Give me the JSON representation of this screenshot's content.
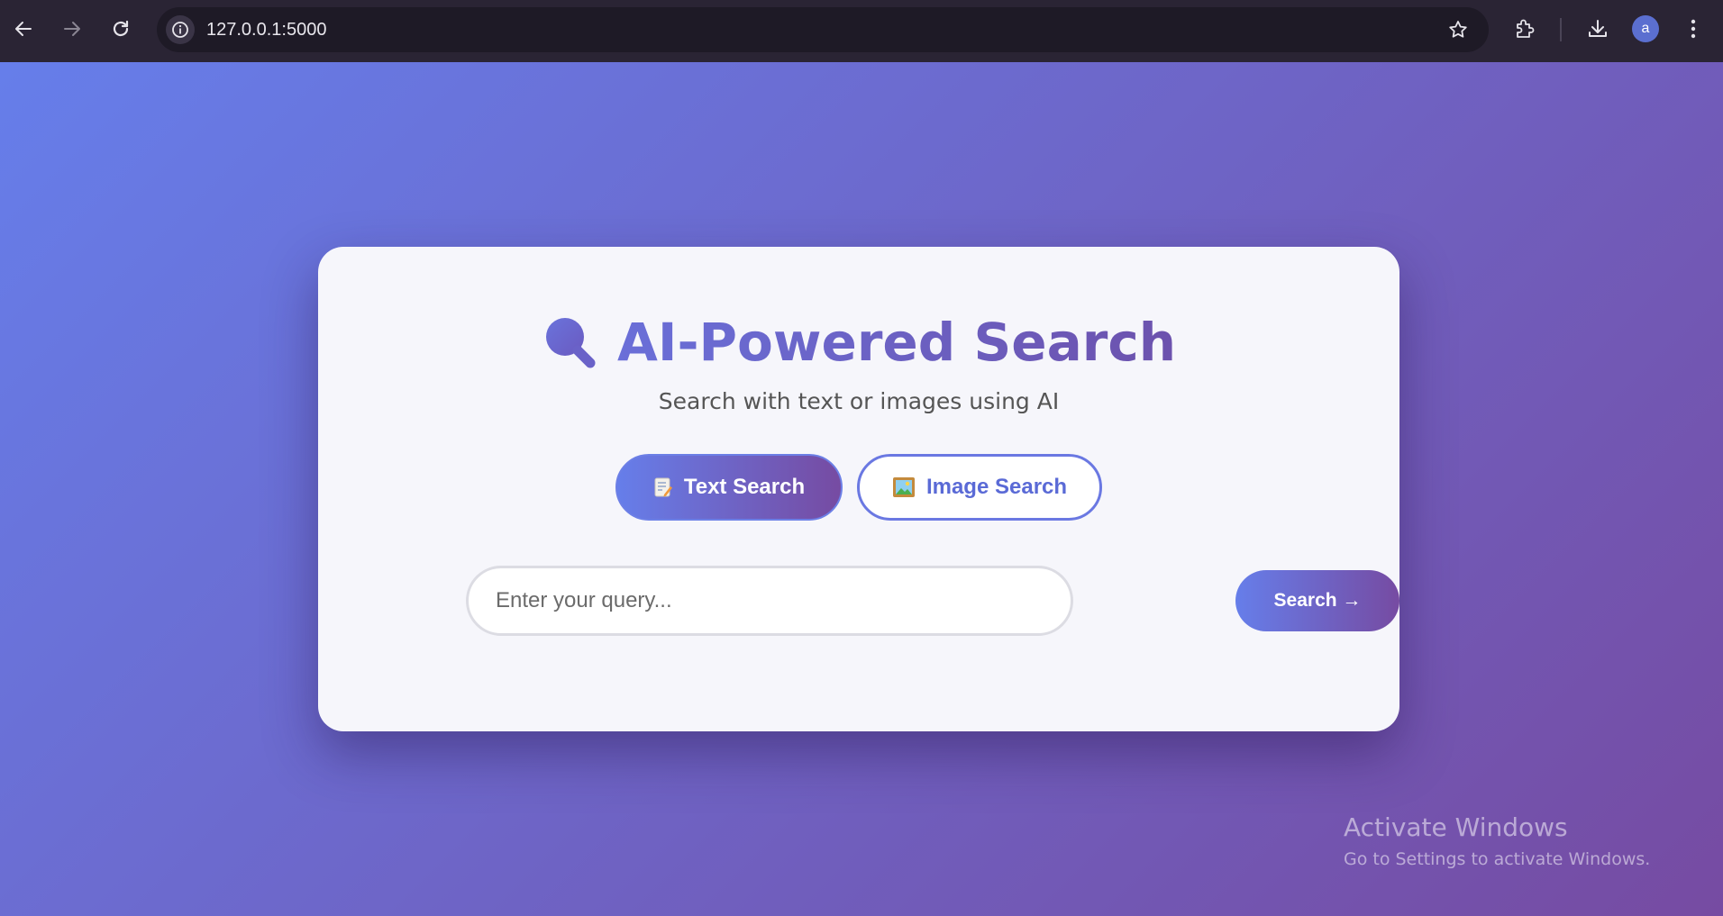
{
  "browser": {
    "url": "127.0.0.1:5000",
    "avatar_letter": "a",
    "icons": [
      "back-arrow-icon",
      "forward-arrow-icon",
      "reload-icon",
      "info-icon",
      "star-icon",
      "extensions-icon",
      "download-icon",
      "menu-dots-icon"
    ]
  },
  "page": {
    "title": "AI-Powered Search",
    "title_icon": "magnifier-icon",
    "subtitle": "Search with text or images using AI",
    "modes": [
      {
        "label": "Text Search",
        "icon": "memo-icon",
        "active": true
      },
      {
        "label": "Image Search",
        "icon": "framed-picture-icon",
        "active": false
      }
    ],
    "search": {
      "placeholder": "Enter your query...",
      "value": "",
      "button_label": "Search →"
    },
    "colors": {
      "gradient_start": "#667eea",
      "gradient_end": "#764ba2",
      "card_bg": "#f6f6fb"
    }
  },
  "watermark": {
    "title": "Activate Windows",
    "subtitle": "Go to Settings to activate Windows."
  }
}
